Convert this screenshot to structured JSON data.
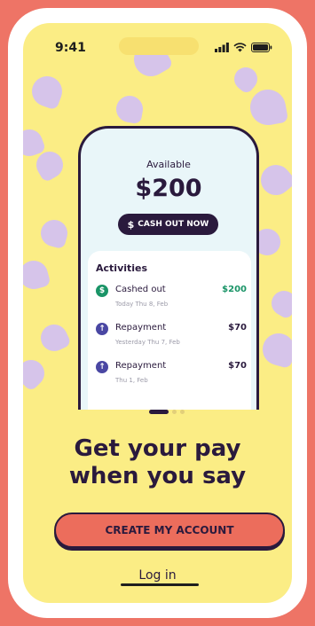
{
  "status_bar": {
    "time": "9:41"
  },
  "card": {
    "available_label": "Available",
    "amount": "$200",
    "cash_out_icon": "$",
    "cash_out_label": "CASH OUT NOW",
    "activities_title": "Activities",
    "activities": [
      {
        "label": "Cashed out",
        "date": "Today Thu 8, Feb",
        "amount": "$200",
        "icon": "dollar-icon",
        "glyph": "$",
        "amount_color": "#1a9467",
        "icon_color": "#1a9467"
      },
      {
        "label": "Repayment",
        "date": "Yesterday Thu 7, Feb",
        "amount": "$70",
        "icon": "arrow-up-icon",
        "glyph": "↑",
        "amount_color": "#2a1a3d",
        "icon_color": "#4a47a3"
      },
      {
        "label": "Repayment",
        "date": "Thu 1, Feb",
        "amount": "$70",
        "icon": "arrow-up-icon",
        "glyph": "↑",
        "amount_color": "#2a1a3d",
        "icon_color": "#4a47a3"
      }
    ]
  },
  "onboarding": {
    "headline_line1": "Get your pay",
    "headline_line2": "when you say",
    "create_account_label": "CREATE MY ACCOUNT",
    "login_label": "Log in"
  },
  "colors": {
    "page_bg": "#ee7466",
    "screen_bg": "#fbed85",
    "hearts": "#d6c4ea",
    "primary_dark": "#2a1a3d",
    "cta_bg": "#ec6d5c"
  }
}
